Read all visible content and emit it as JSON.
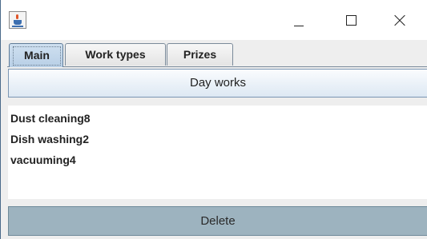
{
  "window": {
    "title": "",
    "controls": [
      "minimize",
      "maximize",
      "close"
    ]
  },
  "tabs": [
    {
      "label": "Main",
      "selected": true
    },
    {
      "label": "Work types",
      "selected": false
    },
    {
      "label": "Prizes",
      "selected": false
    }
  ],
  "main": {
    "day_works_label": "Day works",
    "items": [
      "Dust cleaning8",
      "Dish washing2",
      "vacuuming4"
    ],
    "delete_label": "Delete"
  },
  "colors": {
    "selected_tab": "#b8cfe6",
    "delete_button": "#9db3bf",
    "day_works_button": "#dde8f3"
  }
}
